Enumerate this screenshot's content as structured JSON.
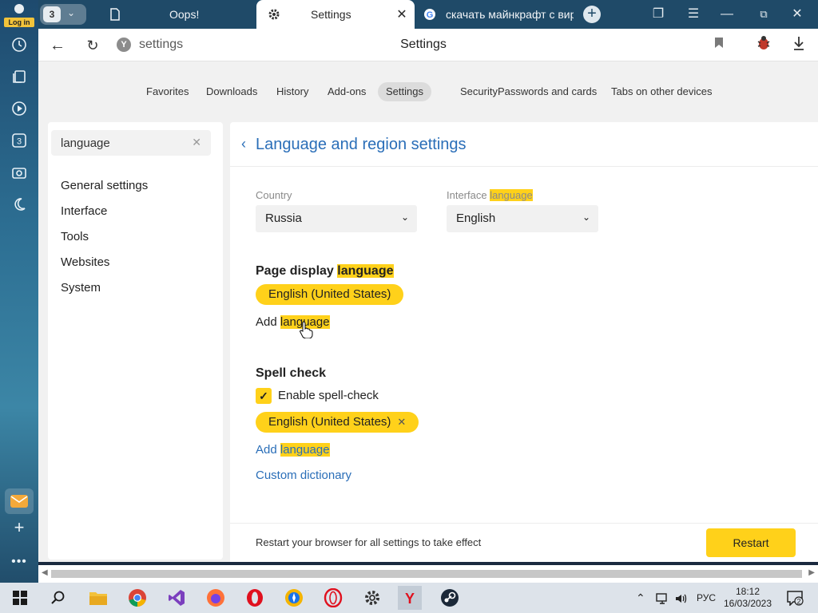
{
  "sidebar_left": {
    "login_label": "Log in",
    "tab_count": "3"
  },
  "tabs": [
    {
      "title": "Oops!",
      "active": false
    },
    {
      "title": "Settings",
      "active": true
    },
    {
      "title": "скачать майнкрафт с вир",
      "active": false
    }
  ],
  "address_bar": {
    "url": "settings",
    "page_title": "Settings"
  },
  "top_nav": [
    "Favorites",
    "Downloads",
    "History",
    "Add-ons",
    "Settings",
    "Security",
    "Passwords and cards",
    "Tabs on other devices"
  ],
  "top_nav_active": "Settings",
  "search": {
    "value": "language",
    "placeholder": ""
  },
  "side_menu": [
    "General settings",
    "Interface",
    "Tools",
    "Websites",
    "System"
  ],
  "section": {
    "title": "Language and region settings",
    "country_label": "Country",
    "country_value": "Russia",
    "interface_label_prefix": "Interface ",
    "interface_label_hl": "language",
    "interface_value": "English",
    "page_display_prefix": "Page display ",
    "page_display_hl": "language",
    "page_display_chip": "English (United States)",
    "add_prefix": "Add ",
    "add_hl": "language",
    "spell_title": "Spell check",
    "spell_enable": "Enable spell-check",
    "spell_checked": true,
    "spell_chip": "English (United States)",
    "spell_add_prefix": "Add ",
    "spell_add_hl": "language",
    "custom_dict": "Custom dictionary"
  },
  "footer": {
    "message": "Restart your browser for all settings to take effect",
    "button": "Restart"
  },
  "taskbar": {
    "language": "РУС",
    "time": "18:12",
    "date": "16/03/2023",
    "notifications": "2"
  },
  "colors": {
    "accent": "#ffd11a",
    "link": "#2a6eb8",
    "tabstrip": "#1f4a68"
  }
}
